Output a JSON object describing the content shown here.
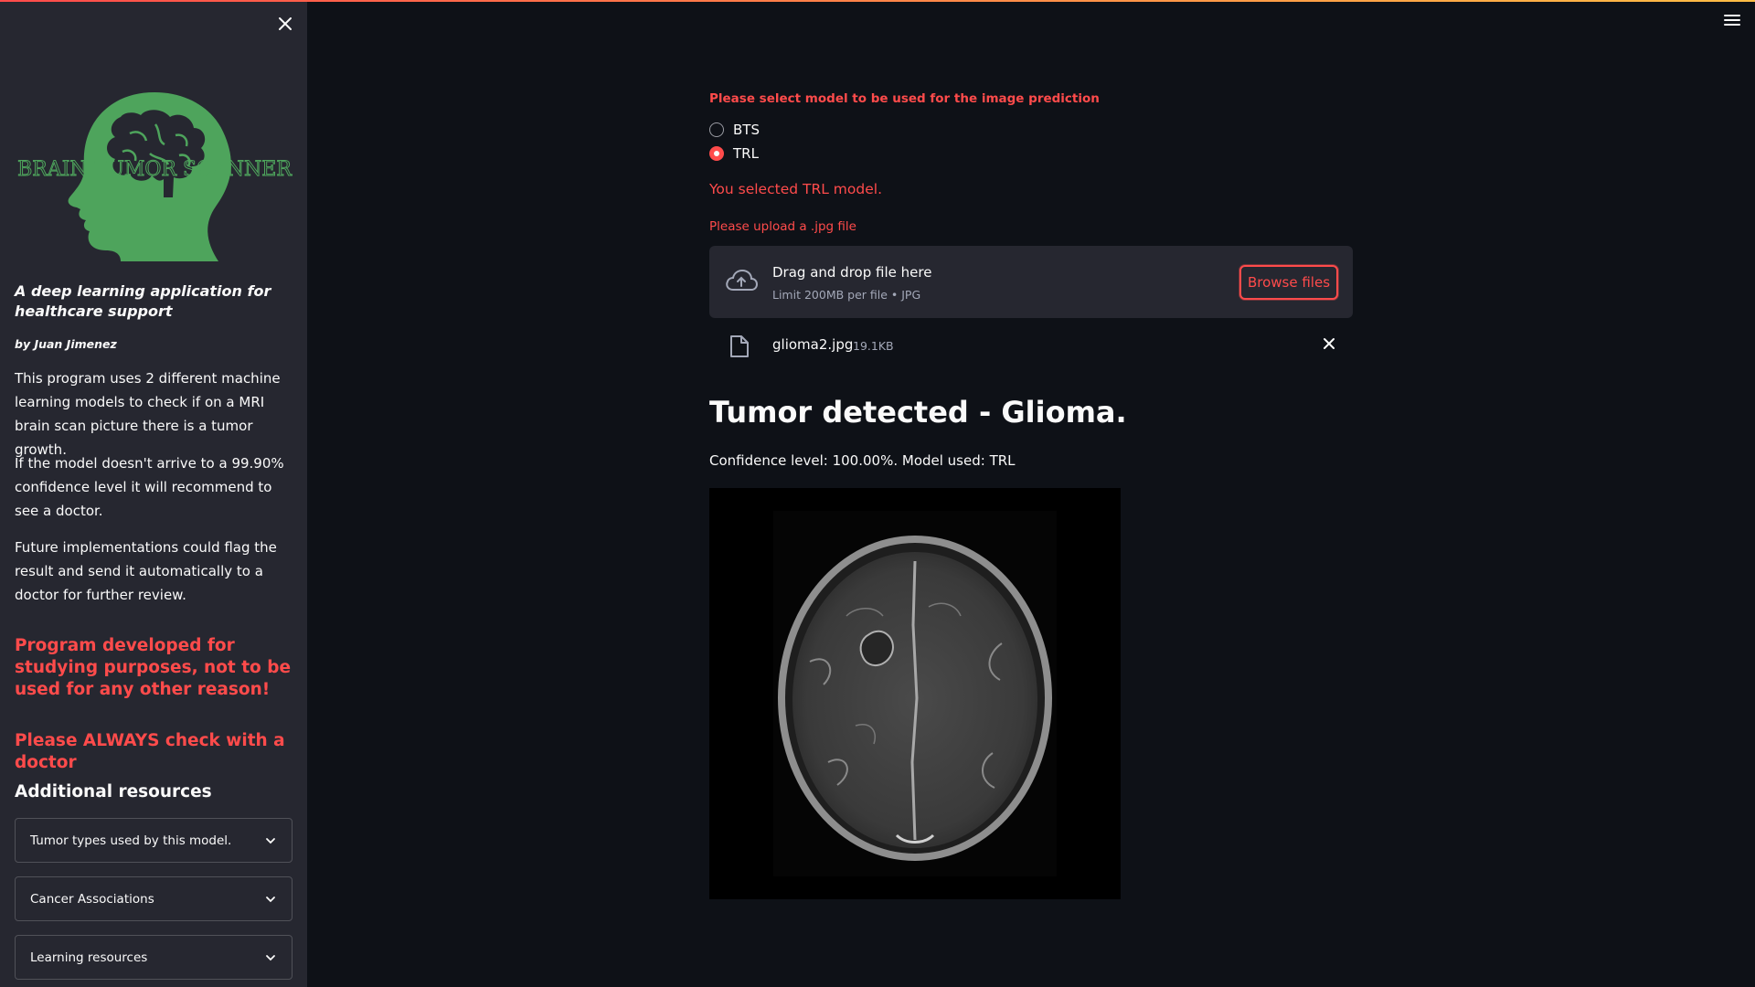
{
  "sidebar": {
    "close_glyph": "✕",
    "logo_text": "BRAIN TUMOR SCANNER",
    "tagline": "A deep learning application for healthcare support",
    "author": "by Juan Jimenez",
    "paragraphs": [
      "This program uses 2 different machine learning models to check if on a MRI brain scan picture there is a tumor growth.",
      "If the model doesn't arrive to a 99.90% confidence level it will recommend to see a doctor.",
      "Future implementations could flag the result and send it automatically to a doctor for further review."
    ],
    "warnings": [
      "Program developed for studying purposes, not to be used for any other reason!",
      "Please ALWAYS check with a doctor"
    ],
    "resources_title": "Additional resources",
    "expanders": [
      "Tumor types used by this model.",
      "Cancer Associations",
      "Learning resources"
    ]
  },
  "main": {
    "model_prompt": "Please select model to be used for the image prediction",
    "model_options": [
      {
        "label": "BTS",
        "checked": false
      },
      {
        "label": "TRL",
        "checked": true
      }
    ],
    "selected_message": "You selected TRL model.",
    "upload_label": "Please upload a .jpg file",
    "dropzone": {
      "title": "Drag and drop file here",
      "subtitle": "Limit 200MB per file • JPG",
      "button": "Browse files"
    },
    "uploaded_file": {
      "name": "glioma2.jpg",
      "size": "19.1KB"
    },
    "result_title": "Tumor detected - Glioma.",
    "confidence": "Confidence level: 100.00%. Model used: TRL"
  },
  "colors": {
    "accent": "#ff4b4b",
    "background": "#0e1117",
    "sidebar": "#262730",
    "logo": "#4ea45c"
  },
  "icons": [
    "close-icon",
    "menu-icon",
    "cloud-upload-icon",
    "file-icon",
    "chevron-down-icon"
  ]
}
